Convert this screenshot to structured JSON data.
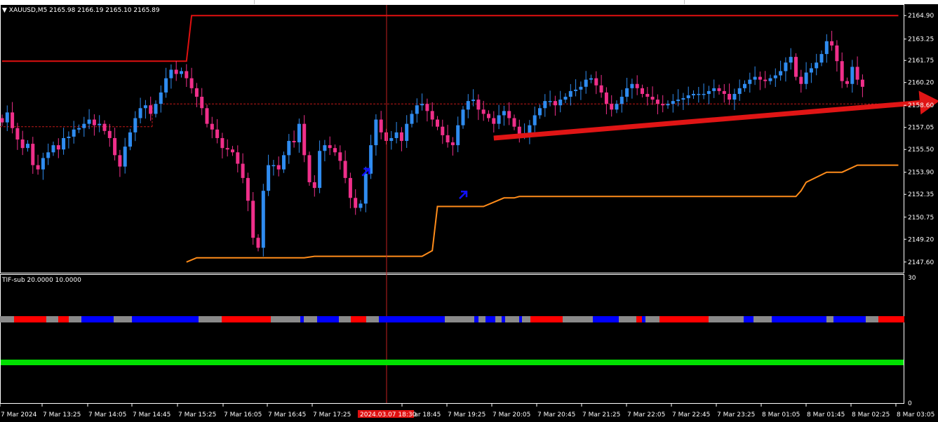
{
  "window": {
    "symbol_caption": "XAUUSD,M5  2165.98 2166.19 2165.10 2165.89",
    "indicator_caption": "TIF-sub 20.0000 10.0000"
  },
  "colors": {
    "background": "#000000",
    "bull_candle": "#2f8cf0",
    "bear_candle": "#ef2f8a",
    "upper_band": "#e01010",
    "lower_band": "#ff8c1a",
    "arrow": "#e01515",
    "signal_arrow": "#1010ff",
    "crosshair": "#c02020",
    "sub_green": "#00e000",
    "strip_gray": "#8a8a8a",
    "strip_red": "#ff0000",
    "strip_blue": "#0000ff",
    "axis": "#ffffff",
    "time_marker_bg": "#e01010"
  },
  "price_axis": {
    "labels": [
      "2164.90",
      "2163.25",
      "2161.75",
      "2160.20",
      "2158.60",
      "2157.05",
      "2155.50",
      "2153.90",
      "2152.35",
      "2150.75",
      "2149.20",
      "2147.60"
    ]
  },
  "sub_axis": {
    "max_label": "30",
    "min_label": "0"
  },
  "time_axis": {
    "labels": [
      "7 Mar 2024",
      "7 Mar 13:25",
      "7 Mar 14:05",
      "7 Mar 14:45",
      "7 Mar 15:25",
      "7 Mar 16:05",
      "7 Mar 16:45",
      "7 Mar 17:25",
      "7 Mar 18:45",
      "7 Mar 19:25",
      "7 Mar 20:05",
      "7 Mar 20:45",
      "7 Mar 21:25",
      "7 Mar 22:05",
      "7 Mar 22:45",
      "7 Mar 23:25",
      "8 Mar 01:05",
      "8 Mar 01:45",
      "8 Mar 02:25",
      "8 Mar 03:05"
    ],
    "crosshair_label": "2024.03.07 18:30"
  },
  "chart_data": {
    "type": "candlestick",
    "symbol": "XAUUSD",
    "timeframe": "M5",
    "ohlc_header": {
      "open": 2165.98,
      "high": 2166.19,
      "low": 2165.1,
      "close": 2165.89
    },
    "ylim": [
      2146.9,
      2165.5
    ],
    "closes": [
      2157.4,
      2158.1,
      2157.0,
      2156.2,
      2155.6,
      2155.9,
      2154.4,
      2154.1,
      2154.9,
      2155.3,
      2155.8,
      2155.5,
      2156.3,
      2156.4,
      2156.9,
      2157.0,
      2157.3,
      2157.6,
      2157.2,
      2157.3,
      2156.8,
      2156.3,
      2155.1,
      2154.3,
      2155.7,
      2156.7,
      2157.7,
      2158.4,
      2158.6,
      2158.0,
      2158.7,
      2159.5,
      2160.5,
      2161.1,
      2160.8,
      2161.0,
      2160.5,
      2159.8,
      2159.2,
      2158.4,
      2157.3,
      2156.9,
      2156.3,
      2155.6,
      2155.5,
      2155.3,
      2154.5,
      2153.5,
      2151.9,
      2149.3,
      2148.6,
      2152.6,
      2154.4,
      2154.4,
      2154.1,
      2155.1,
      2156.1,
      2156.0,
      2157.3,
      2155.1,
      2153.2,
      2152.8,
      2155.4,
      2155.8,
      2155.6,
      2155.3,
      2154.7,
      2153.5,
      2152.1,
      2151.4,
      2151.7,
      2153.8,
      2155.8,
      2157.6,
      2156.7,
      2156.1,
      2156.3,
      2156.7,
      2156.1,
      2157.3,
      2158.0,
      2158.6,
      2158.7,
      2158.2,
      2157.6,
      2157.1,
      2156.5,
      2156.0,
      2155.8,
      2157.2,
      2158.3,
      2158.9,
      2159.0,
      2158.3,
      2158.0,
      2157.7,
      2157.3,
      2157.9,
      2158.2,
      2157.7,
      2157.1,
      2156.6,
      2156.6,
      2157.2,
      2157.9,
      2158.4,
      2158.9,
      2158.9,
      2158.6,
      2159.0,
      2159.2,
      2159.6,
      2159.7,
      2159.9,
      2160.4,
      2160.5,
      2160.0,
      2159.5,
      2158.7,
      2158.3,
      2158.7,
      2159.2,
      2159.8,
      2160.1,
      2159.8,
      2159.4,
      2159.2,
      2159.0,
      2158.7,
      2158.6,
      2158.7,
      2158.9,
      2159.0,
      2159.1,
      2159.3,
      2159.4,
      2159.4,
      2159.4,
      2159.6,
      2159.8,
      2159.6,
      2159.4,
      2159.0,
      2159.4,
      2159.8,
      2160.1,
      2160.4,
      2160.6,
      2160.4,
      2160.3,
      2160.5,
      2160.7,
      2161.0,
      2161.6,
      2162.0,
      2160.6,
      2160.1,
      2160.9,
      2161.2,
      2161.6,
      2162.2,
      2163.1,
      2162.8,
      2161.7,
      2160.3,
      2160.1,
      2161.3,
      2160.4,
      2159.9
    ]
  },
  "bands": {
    "upper_line": {
      "from_bar": 0,
      "steps": [
        [
          0,
          2161.7
        ],
        [
          36,
          2161.7
        ],
        [
          37,
          2164.9
        ],
        [
          175,
          2164.9
        ]
      ]
    },
    "lower_line": {
      "steps": [
        [
          36,
          2147.6
        ],
        [
          38,
          2147.9
        ],
        [
          59,
          2147.9
        ],
        [
          61,
          2148.0
        ],
        [
          82,
          2148.0
        ],
        [
          84,
          2148.4
        ],
        [
          85,
          2151.5
        ],
        [
          94,
          2151.5
        ],
        [
          96,
          2151.8
        ],
        [
          98,
          2152.1
        ],
        [
          100,
          2152.1
        ],
        [
          101,
          2152.2
        ],
        [
          155,
          2152.2
        ],
        [
          156,
          2152.6
        ],
        [
          157,
          2153.2
        ],
        [
          161,
          2153.9
        ],
        [
          164,
          2153.9
        ],
        [
          167,
          2154.4
        ],
        [
          175,
          2154.4
        ]
      ]
    },
    "level_line_1": 2157.1,
    "level_line_2": 2158.7
  },
  "trend_arrow": {
    "from": [
      96,
      2156.3
    ],
    "to": [
      183,
      2158.9
    ]
  },
  "signal_arrows": [
    {
      "bar": 71,
      "price": 2154.0
    },
    {
      "bar": 90,
      "price": 2152.4
    }
  ],
  "strip_segments": [
    [
      "gray",
      0,
      20
    ],
    [
      "red",
      20,
      66
    ],
    [
      "gray",
      66,
      83
    ],
    [
      "red",
      83,
      98
    ],
    [
      "gray",
      98,
      116
    ],
    [
      "blue",
      116,
      162
    ],
    [
      "gray",
      162,
      188
    ],
    [
      "blue",
      188,
      283
    ],
    [
      "gray",
      283,
      316
    ],
    [
      "red",
      316,
      386
    ],
    [
      "gray",
      386,
      428
    ],
    [
      "blue",
      428,
      433
    ],
    [
      "gray",
      433,
      452
    ],
    [
      "blue",
      452,
      483
    ],
    [
      "gray",
      483,
      500
    ],
    [
      "red",
      500,
      522
    ],
    [
      "gray",
      522,
      540
    ],
    [
      "blue",
      540,
      634
    ],
    [
      "gray",
      634,
      676
    ],
    [
      "blue",
      676,
      682
    ],
    [
      "gray",
      682,
      692
    ],
    [
      "blue",
      692,
      706
    ],
    [
      "gray",
      706,
      715
    ],
    [
      "blue",
      715,
      720
    ],
    [
      "gray",
      720,
      740
    ],
    [
      "blue",
      740,
      744
    ],
    [
      "gray",
      744,
      756
    ],
    [
      "red",
      756,
      802
    ],
    [
      "gray",
      802,
      845
    ],
    [
      "blue",
      845,
      882
    ],
    [
      "gray",
      882,
      907
    ],
    [
      "red",
      907,
      915
    ],
    [
      "blue",
      915,
      920
    ],
    [
      "gray",
      920,
      940
    ],
    [
      "red",
      940,
      1010
    ],
    [
      "gray",
      1010,
      1060
    ],
    [
      "blue",
      1060,
      1074
    ],
    [
      "gray",
      1074,
      1100
    ],
    [
      "blue",
      1100,
      1178
    ],
    [
      "gray",
      1178,
      1188
    ],
    [
      "blue",
      1188,
      1234
    ],
    [
      "gray",
      1234,
      1252
    ],
    [
      "red",
      1252,
      1289
    ]
  ]
}
